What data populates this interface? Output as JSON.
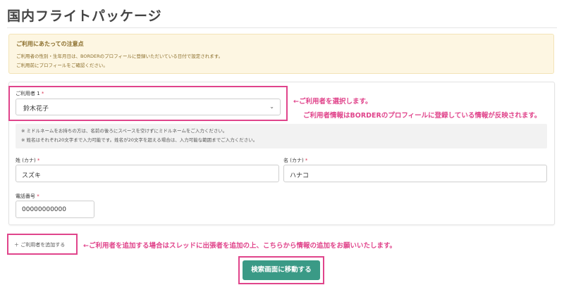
{
  "page": {
    "title": "国内フライトパッケージ"
  },
  "notice": {
    "title": "ご利用にあたっての注意点",
    "lines": [
      "ご利用者の性別・生年月日は、BORDERのプロフィールに登録いただいている日付で設定されます。",
      "ご利用前にプロフィールをご確認ください。"
    ]
  },
  "form": {
    "user_label": "ご利用者 1",
    "required_mark": "*",
    "user_selected": "鈴木花子",
    "help_lines": [
      "※ ミドルネームをお持ちの方は、名前の後ろにスペースを空けずにミドルネームをご入力ください。",
      "※ 姓名はそれぞれ20文字まで入力可能です。姓名が20文字を超える場合は、入力可能な範囲までご入力ください。"
    ],
    "last_name_label": "姓 (カナ)",
    "last_name_value": "スズキ",
    "first_name_label": "名 (カナ)",
    "first_name_value": "ハナコ",
    "phone_label": "電話番号",
    "phone_value": "00000000000"
  },
  "annotations": {
    "select_user": "←ご利用者を選択します。",
    "select_user_detail": "ご利用者情報はBORDERのプロフィールに登録している情報が反映されます。",
    "add_user": "←ご利用者を追加する場合はスレッドに出張者を追加の上、こちらから情報の追加をお願いいたします。"
  },
  "actions": {
    "add_user": "＋ ご利用者を追加する",
    "search": "検索画面に移動する"
  },
  "colors": {
    "accent_pink": "#e0448b",
    "button_teal": "#3a9a86",
    "notice_bg": "#fdf6e2"
  }
}
